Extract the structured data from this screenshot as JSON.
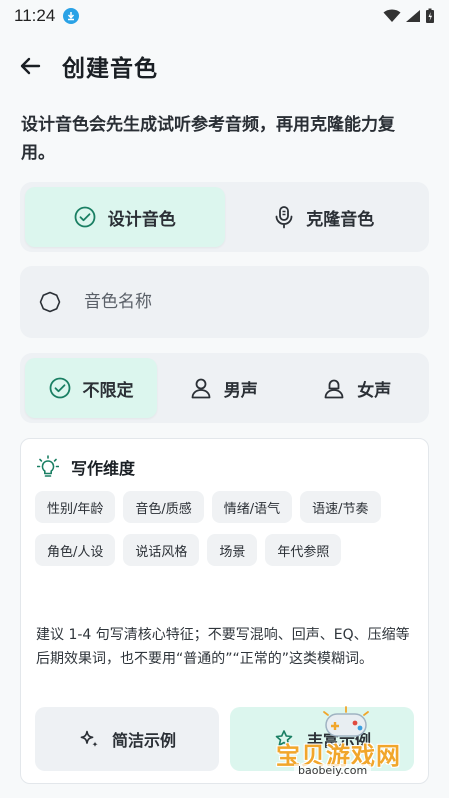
{
  "status_bar": {
    "time": "11:24"
  },
  "header": {
    "title": "创建音色"
  },
  "description": "设计音色会先生成试听参考音频，再用克隆能力复用。",
  "mode_tabs": [
    {
      "label": "设计音色",
      "icon": "check-circle-icon",
      "active": true
    },
    {
      "label": "克隆音色",
      "icon": "microphone-icon",
      "active": false
    }
  ],
  "name_field": {
    "placeholder": "音色名称",
    "value": ""
  },
  "gender_tabs": [
    {
      "label": "不限定",
      "icon": "check-circle-icon",
      "active": true
    },
    {
      "label": "男声",
      "icon": "person-icon",
      "active": false
    },
    {
      "label": "女声",
      "icon": "person-female-icon",
      "active": false
    }
  ],
  "tips": {
    "title": "写作维度",
    "tags": [
      "性别/年龄",
      "音色/质感",
      "情绪/语气",
      "语速/节奏",
      "角色/人设",
      "说话风格",
      "场景",
      "年代参照"
    ],
    "text": "建议 1-4 句写清核心特征；不要写混响、回声、EQ、压缩等后期效果词，也不要用“普通的”“正常的”这类模糊词。",
    "buttons": {
      "simple": "简洁示例",
      "rich": "丰富示例"
    }
  },
  "watermark": {
    "text": "宝贝游戏网",
    "url": "baobeiy.com"
  },
  "colors": {
    "accent_bg": "#dcf6ee",
    "accent": "#1a7f63",
    "card_bg": "#eef1f4"
  }
}
